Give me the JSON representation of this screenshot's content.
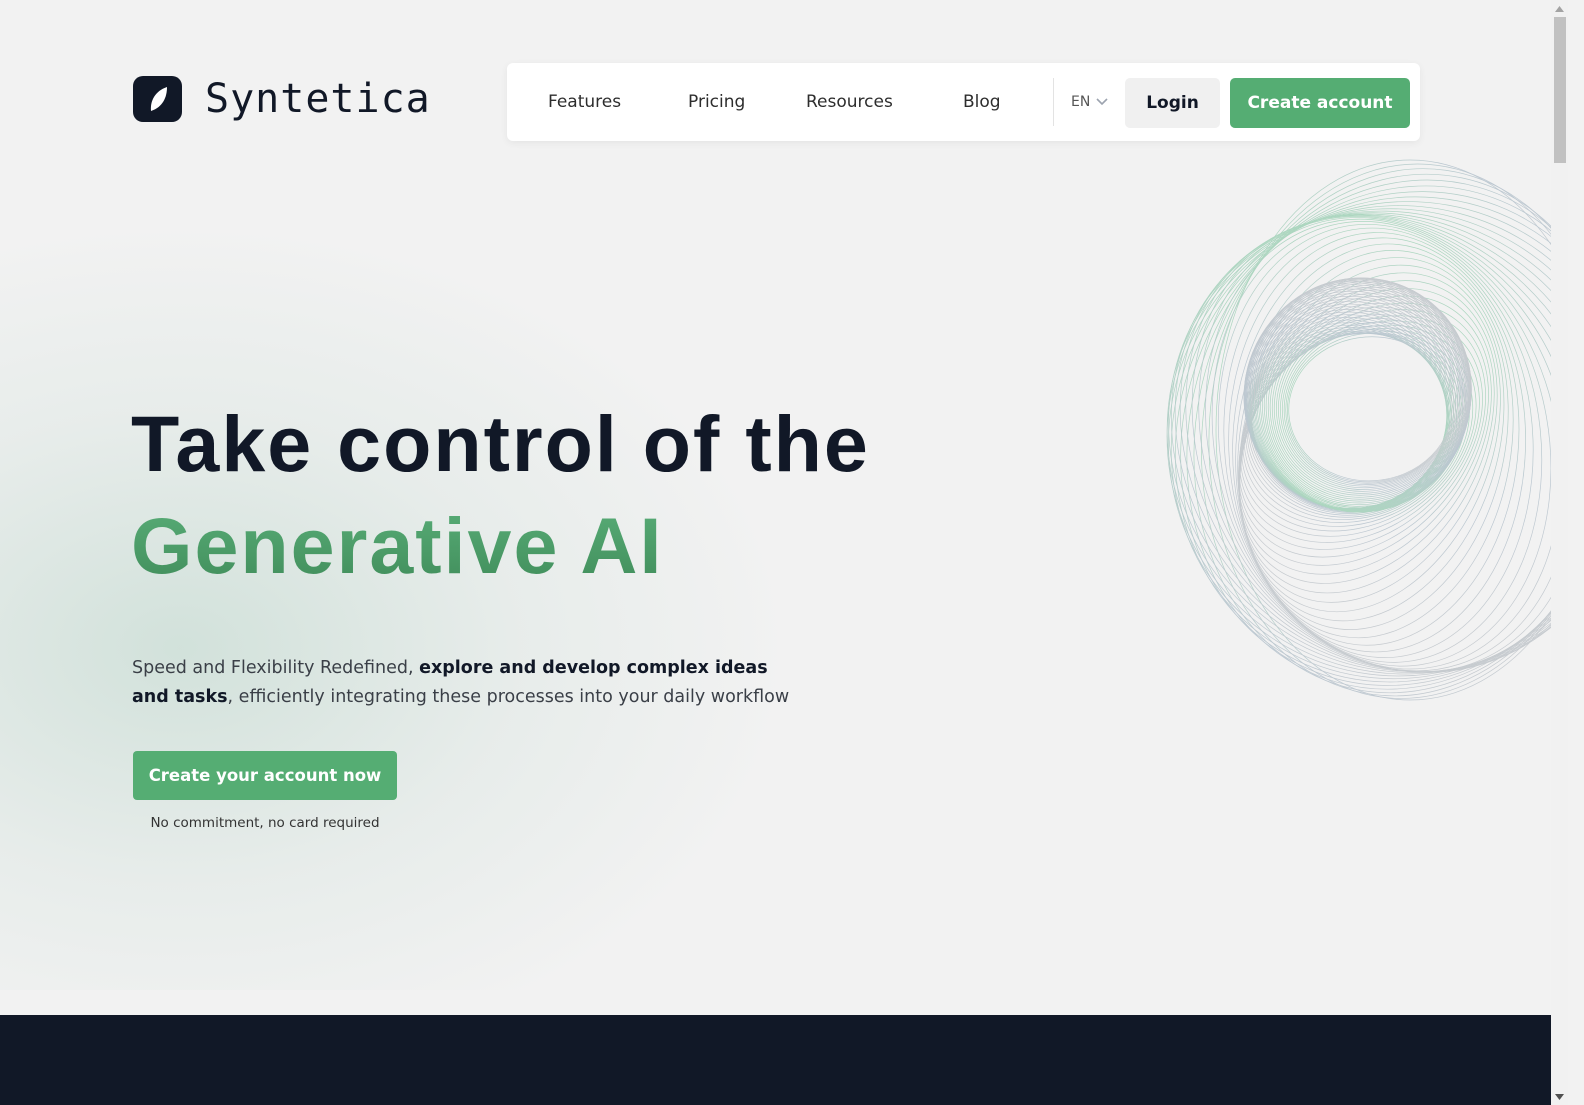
{
  "brand": {
    "name": "Syntetica",
    "logo_icon": "leaf-icon",
    "accent_color": "#55ad73",
    "dark_color": "#111827"
  },
  "nav": {
    "links": [
      {
        "label": "Features"
      },
      {
        "label": "Pricing"
      },
      {
        "label": "Resources"
      },
      {
        "label": "Blog"
      }
    ],
    "language": {
      "selected": "EN",
      "icon": "chevron-down-icon"
    },
    "login_label": "Login",
    "create_account_label": "Create account"
  },
  "hero": {
    "title_line1": "Take control of the",
    "title_line2": "Generative AI",
    "subtitle_plain_1": "Speed and Flexibility Redefined, ",
    "subtitle_bold_1": "explore and develop complex ideas and tasks",
    "subtitle_plain_2": ", efficiently integrating these processes into your daily workflow",
    "cta_label": "Create your account now",
    "cta_note": "No commitment, no card required"
  },
  "decoration": {
    "graphic": "spiral-wireframe-illustration"
  },
  "scrollbar": {
    "up_icon": "arrow-up-icon",
    "down_icon": "arrow-down-icon"
  }
}
